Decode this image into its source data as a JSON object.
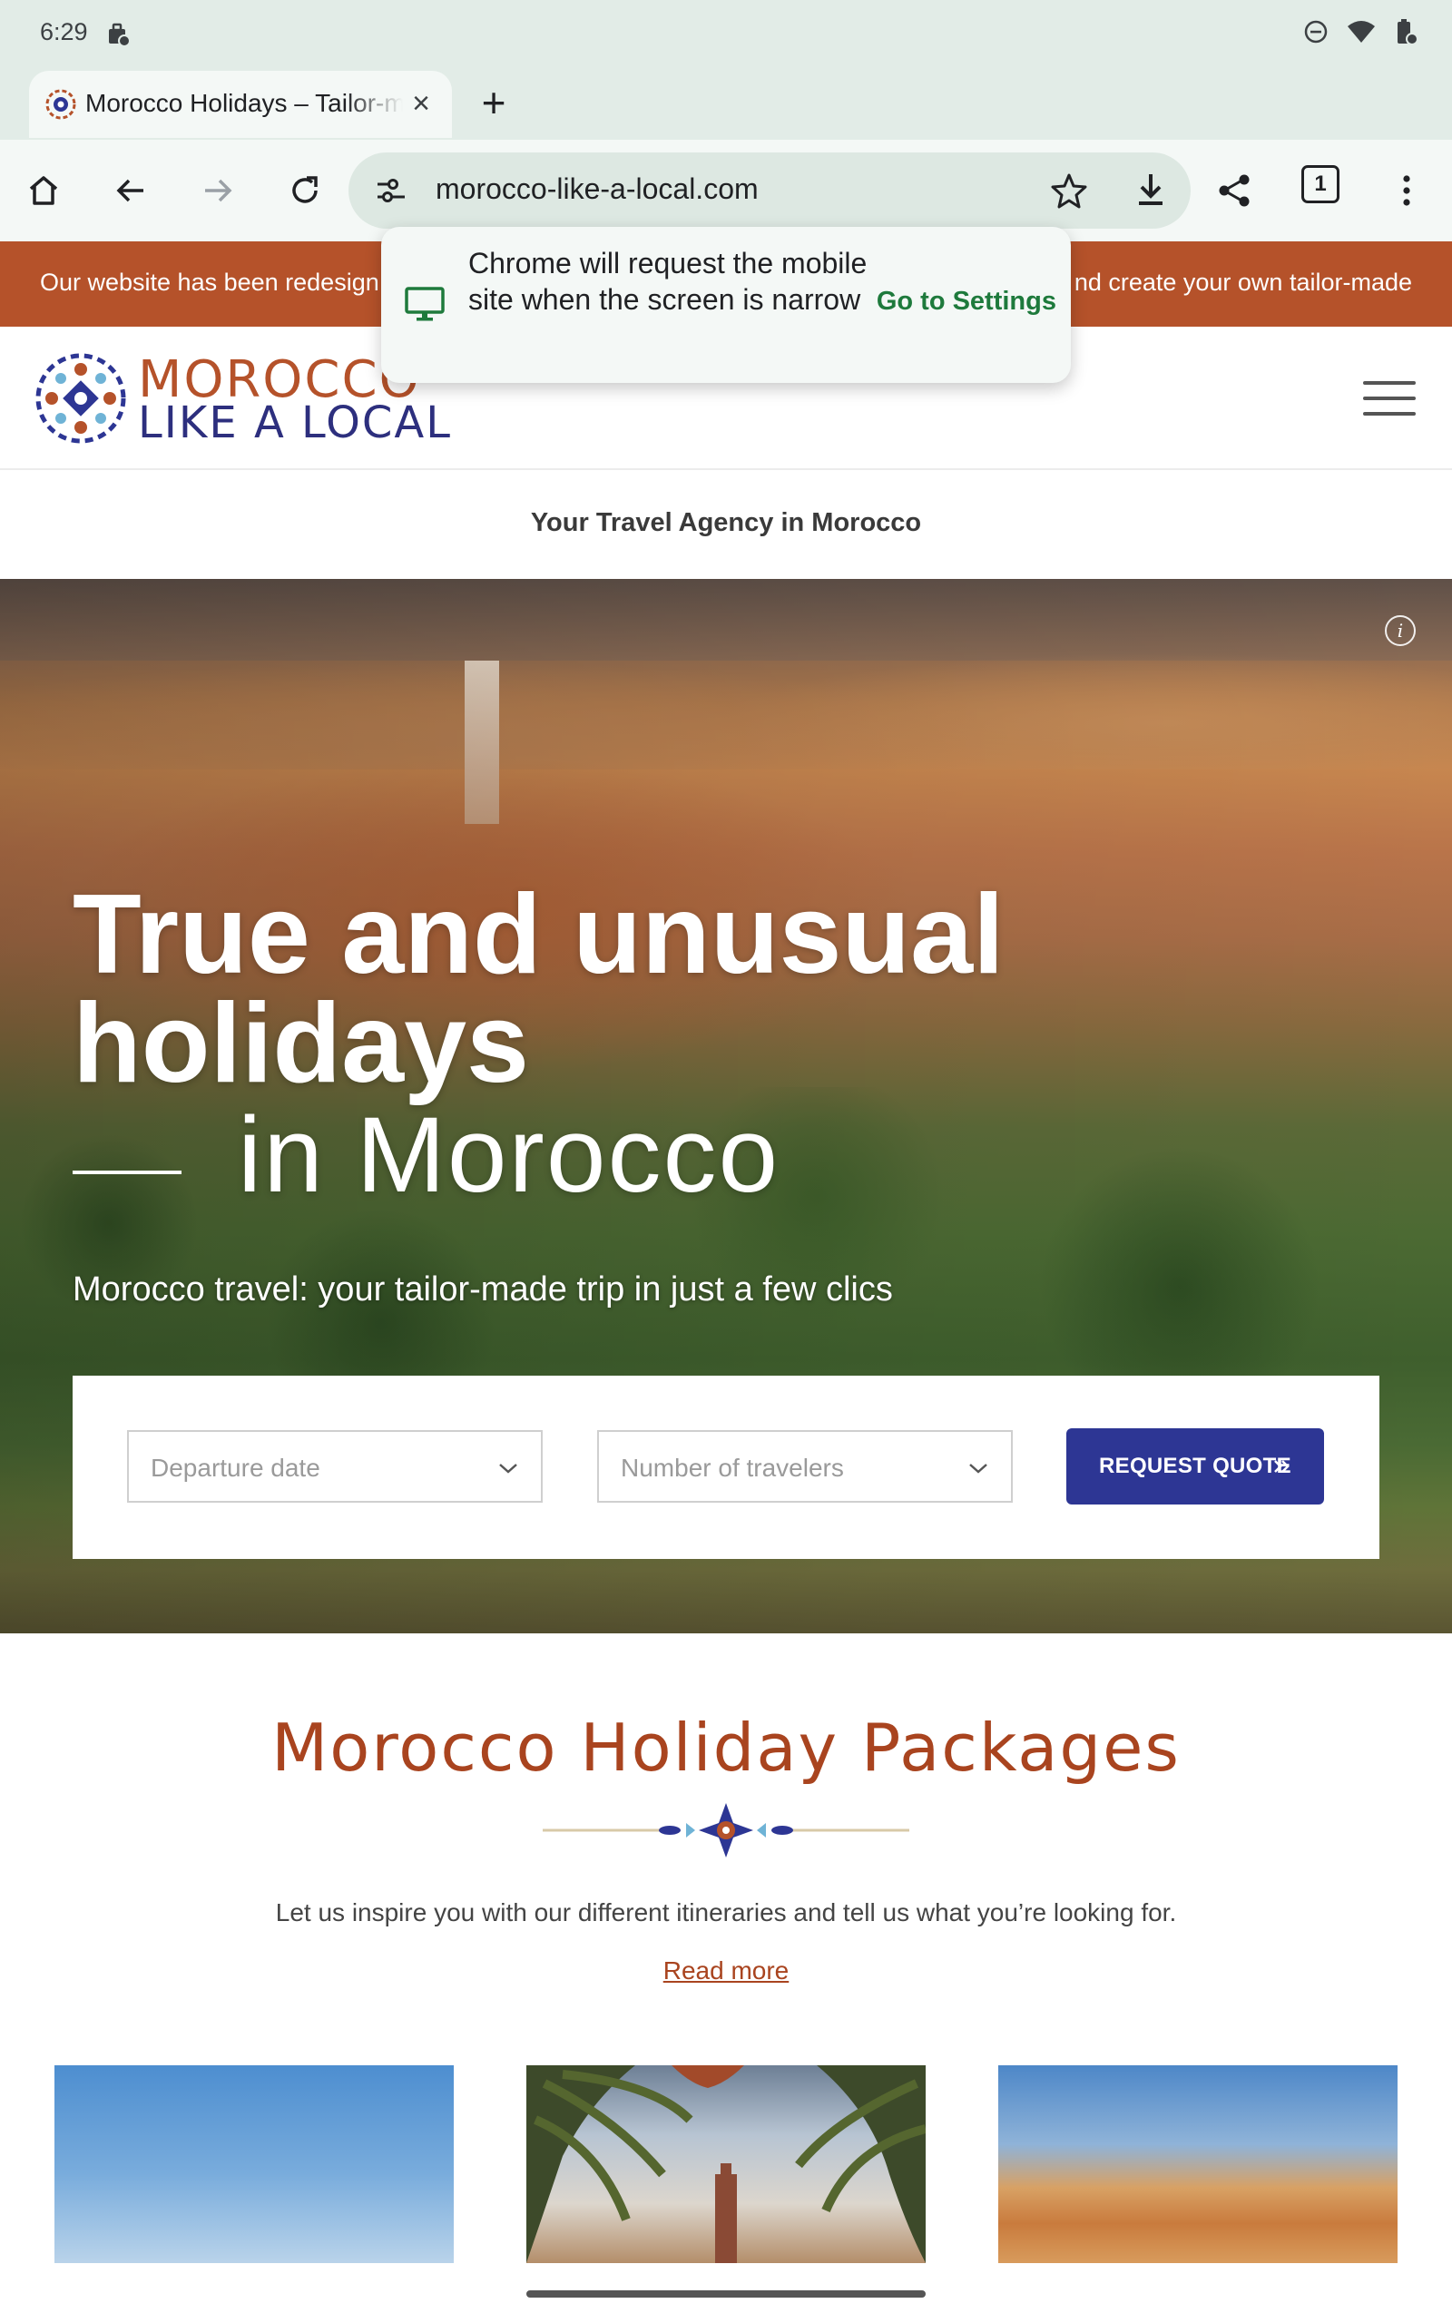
{
  "status_bar": {
    "time": "6:29"
  },
  "tab": {
    "title": "Morocco Holidays – Tailor-made",
    "close_label": "×"
  },
  "toolbar": {
    "url": "morocco-like-a-local.com",
    "tab_count": "1"
  },
  "popup": {
    "message": "Chrome will request the mobile site when the screen is narrow",
    "action": "Go to Settings"
  },
  "site": {
    "banner_left": "Our website has been redesign",
    "banner_right": "nd create your own tailor-made",
    "logo_line1": "MOROCCO",
    "logo_line2": "LIKE A LOCAL",
    "tagline": "Your Travel Agency in Morocco"
  },
  "hero": {
    "title_line1": "True and unusual",
    "title_line2": "holidays",
    "title_line3": "in Morocco",
    "subtitle": "Morocco travel: your tailor-made trip in just a few clics",
    "departure_placeholder": "Departure date",
    "travelers_placeholder": "Number of travelers",
    "quote_button": "REQUEST QUOTE"
  },
  "packages": {
    "title": "Morocco Holiday Packages",
    "description": "Let us inspire you with our different itineraries and tell us what you’re looking for.",
    "read_more": "Read more"
  },
  "colors": {
    "brand_terracotta": "#b5522a",
    "brand_navy": "#2d3694",
    "chrome_surface": "#f4f8f6",
    "chrome_accent": "#1e7a3c"
  },
  "icons": {
    "status_left": "work-profile-icon",
    "status_right": [
      "dnd-icon",
      "wifi-icon",
      "battery-icon"
    ],
    "toolbar": [
      "home-icon",
      "back-icon",
      "forward-icon",
      "reload-icon",
      "tune-icon",
      "star-icon",
      "download-icon",
      "share-icon",
      "tab-switcher-icon",
      "more-icon"
    ]
  }
}
